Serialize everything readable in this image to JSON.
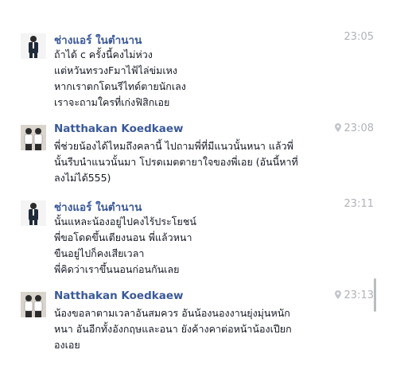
{
  "messages": [
    {
      "sender": "ช่างแอร์ ในตำนาน",
      "time": "23:05",
      "avatar_icon": "male-avatar-icon",
      "has_location": false,
      "lines": [
        "ถ้าได้ c ครั้งนี้คงไม่ห่วง",
        "แต่หวันทรวงFมาไฟ้ไล่ข่มเหง",
        "หากเราตกโดนรีไทด์ตายนักเลง",
        "เราจะถามใครที่เก่งฟิสิกเอย"
      ]
    },
    {
      "sender": "Natthakan Koedkaew",
      "time": "23:08",
      "avatar_icon": "couple-avatar-icon",
      "has_location": true,
      "lines": [
        "พี่ช่วยน้องได้ไหมถึงคลานี้ ไปถามพี่ที่มีแนวนั้นหนา แล้วพี่",
        "นั้นรีบนำแนวนั้นมา โปรดเมตตายาใจของพี่เอย (อันนี้หาที่",
        "ลงไม่ได้555)"
      ]
    },
    {
      "sender": "ช่างแอร์ ในตำนาน",
      "time": "23:11",
      "avatar_icon": "male-avatar-icon",
      "has_location": false,
      "lines": [
        "นั้นแหละน้องอยู่ไปคงไร้ประโยชน์",
        "พี่ขอโดดขึ้นเตียงนอน พี่แล้วหนา",
        "ขืนอยู่ไปก็คงเสียเวลา",
        "พี่คิดว่าเราขึ้นนอนก่อนกันเลย"
      ]
    },
    {
      "sender": "Natthakan Koedkaew",
      "time": "23:13",
      "avatar_icon": "couple-avatar-icon",
      "has_location": true,
      "lines": [
        "น้องขอลาตามเวลาอันสมควร อันน้องนองงานยุ่งมุ่นหนัก",
        "หนา อันอีกทั้งอังกฤษและอนา ยังค้างคาต่อหน้าน้องเปียก",
        "องเอย"
      ]
    }
  ],
  "colors": {
    "sender": "#3b5998",
    "time": "#b0b3b8",
    "text": "#141823",
    "scrollbar": "#b9bcc1"
  }
}
